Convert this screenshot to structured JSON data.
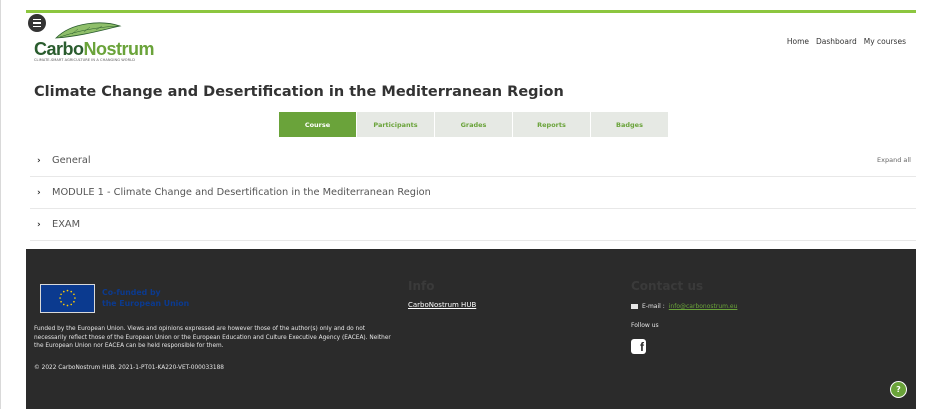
{
  "header": {
    "logo": {
      "text_carbo": "Carbo",
      "text_nostrum": "Nostrum",
      "tagline": "CLIMATE-SMART AGRICULTURE IN A CHANGING WORLD"
    },
    "nav": {
      "home": "Home",
      "dashboard": "Dashboard",
      "my_courses": "My courses"
    }
  },
  "course": {
    "title": "Climate Change and Desertification in the Mediterranean Region",
    "tabs": [
      {
        "label": "Course",
        "active": true
      },
      {
        "label": "Participants",
        "active": false
      },
      {
        "label": "Grades",
        "active": false
      },
      {
        "label": "Reports",
        "active": false
      },
      {
        "label": "Badges",
        "active": false
      }
    ],
    "expand_all": "Expand all",
    "sections": [
      {
        "label": "General"
      },
      {
        "label": "MODULE 1 - Climate Change and Desertification in the Mediterranean Region"
      },
      {
        "label": "EXAM"
      }
    ]
  },
  "footer": {
    "eu_line1": "Co-funded by",
    "eu_line2": "the European Union",
    "note": "Funded by the European Union. Views and opinions expressed are however those of the author(s) only and do not necessarily reflect those of the European Union or the European Education and Culture Executive Agency (EACEA). Neither the European Union nor EACEA can be held responsible for them.",
    "copyright": "© 2022 CarboNostrum HUB. 2021-1-PT01-KA220-VET-000033188",
    "info_title": "Info",
    "info_link": "CarboNostrum HUB",
    "contact_title": "Contact us",
    "email_label": "E-mail : ",
    "email_value": "info@carbonostrum.eu",
    "follow_us": "Follow us",
    "help_label": "?"
  },
  "colors": {
    "accent": "#6aa33a",
    "footer_bg": "#2b2b2b",
    "eu_blue": "#0b3a8f"
  },
  "icons": [
    "menu-icon",
    "chevron-right-icon",
    "mail-icon",
    "facebook-icon",
    "help-icon"
  ]
}
